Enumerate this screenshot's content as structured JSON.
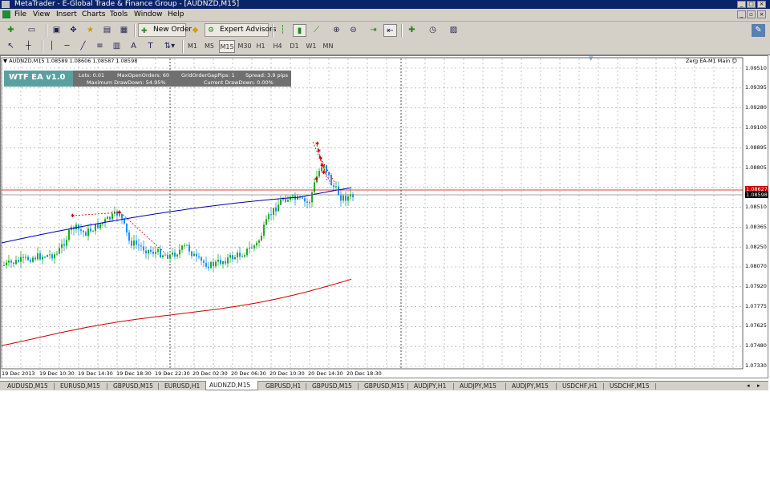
{
  "window": {
    "title": "MetaTrader - E-Global Trade & Finance Group - [AUDNZD,M15]"
  },
  "menu": [
    "File",
    "View",
    "Insert",
    "Charts",
    "Tools",
    "Window",
    "Help"
  ],
  "toolbar": {
    "new_order": "New Order",
    "expert_advisors": "Expert Advisors",
    "timeframes": [
      "M1",
      "M5",
      "M15",
      "M30",
      "H1",
      "H4",
      "D1",
      "W1",
      "MN"
    ],
    "active_timeframe": "M15"
  },
  "chart": {
    "header": "AUDNZD,M15  1.08589 1.08606 1.08587 1.08598",
    "indicator_label": "Zerg EA-M1 Main",
    "ea": {
      "name": "WTF EA v1.0",
      "lots": "Lots: 0.01",
      "max_open": "MaxOpenOrders: 60",
      "grid_gap": "GridOrderGapPips: 1",
      "spread": "Spread: 3.9 pips",
      "max_dd": "Maximum DrawDown: 54.95%",
      "cur_dd": "Current DrawDown: 0.00%"
    },
    "price_labels": [
      "1.09510",
      "1.09395",
      "1.09280",
      "1.09100",
      "1.08895",
      "1.08805",
      "1.08510",
      "1.08365",
      "1.08250",
      "1.08070",
      "1.07920",
      "1.07775",
      "1.07625",
      "1.07480",
      "1.07330"
    ],
    "bid_label": "1.08598",
    "ask_label": "1.08627",
    "time_labels": [
      "19 Dec 2013",
      "19 Dec 10:30",
      "19 Dec 14:30",
      "19 Dec 18:30",
      "19 Dec 22:30",
      "20 Dec 02:30",
      "20 Dec 06:30",
      "20 Dec 10:30",
      "20 Dec 14:30",
      "20 Dec 18:30"
    ],
    "colors": {
      "bull": "#22aa22",
      "bear": "#1e90ff",
      "ma_slow": "#cc0000",
      "ma_fast": "#0000aa",
      "bid": "#cc0000"
    }
  },
  "tabs": [
    "AUDUSD,M15",
    "EURUSD,M15",
    "GBPUSD,M15",
    "EURUSD,H1",
    "AUDNZD,M15",
    "GBPUSD,H1",
    "GBPUSD,M15",
    "GBPUSD,M15",
    "AUDJPY,H1",
    "AUDJPY,M15",
    "AUDJPY,M15",
    "USDCHF,H1",
    "USDCHF,M15"
  ],
  "active_tab": "AUDNZD,M15"
}
